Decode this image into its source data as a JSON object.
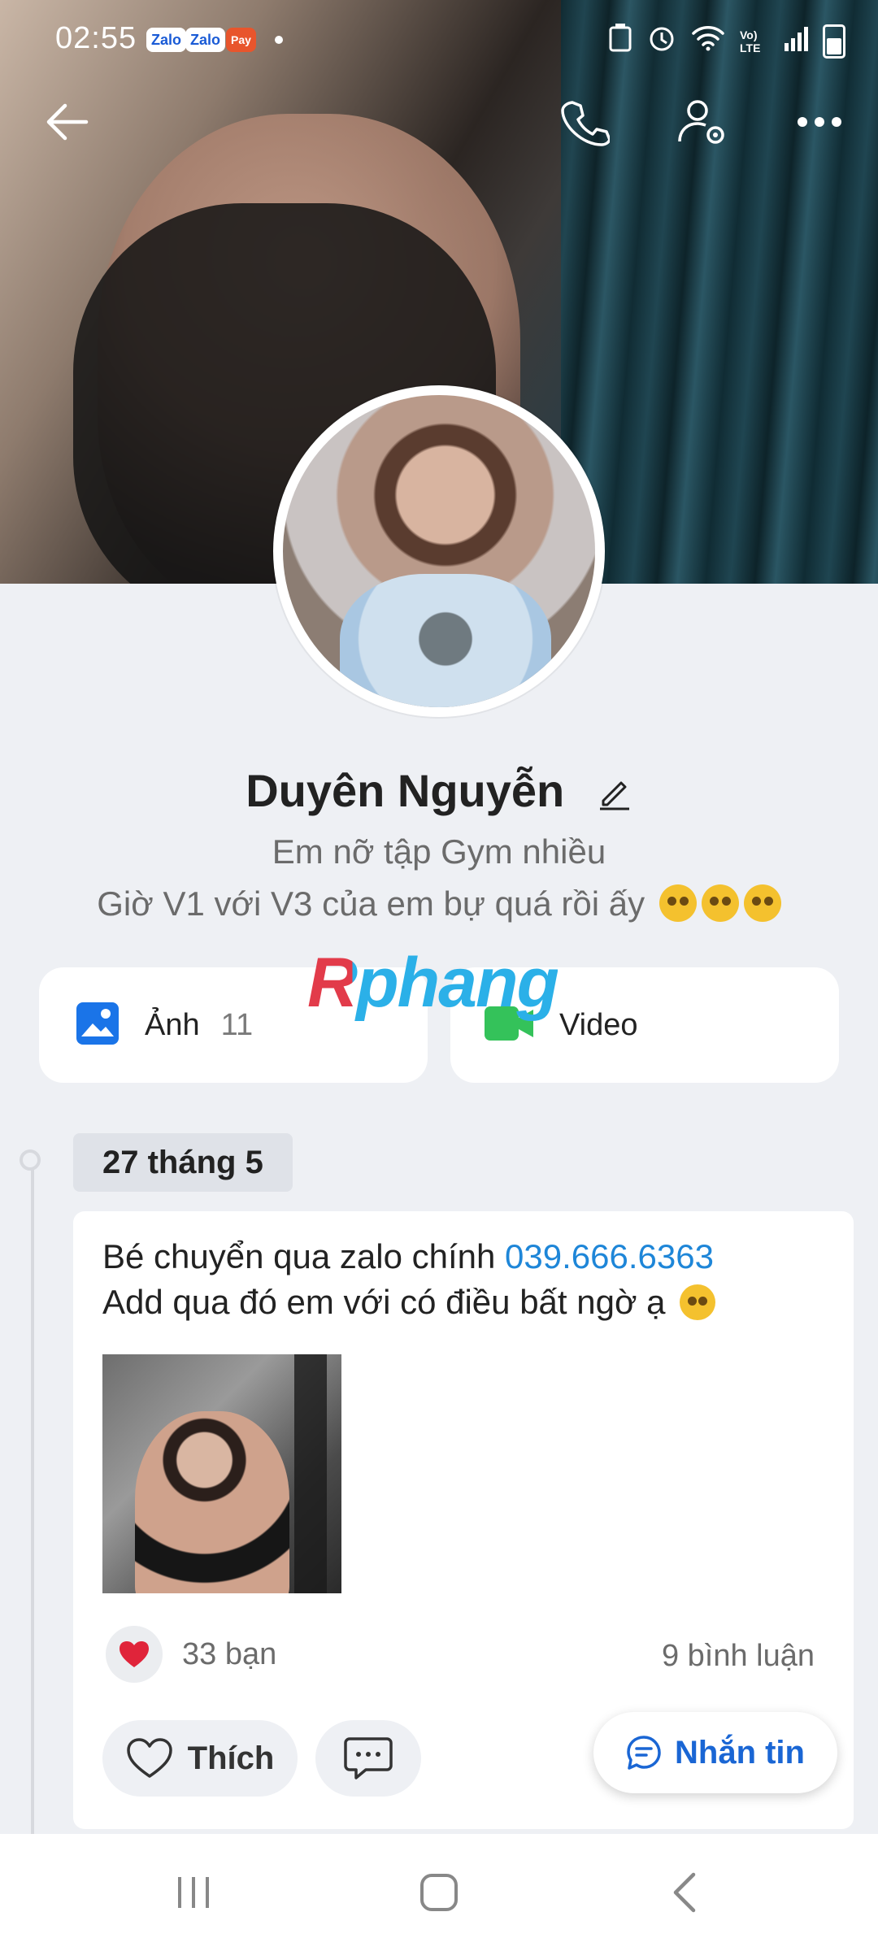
{
  "status_bar": {
    "time": "02:55",
    "notifications": [
      "Zalo",
      "Zalo",
      "Pay"
    ],
    "network_label": "Vo) LTE"
  },
  "header": {
    "back_icon": "back-arrow-icon",
    "call_icon": "phone-icon",
    "settings_icon": "user-settings-icon",
    "more_icon": "more-dots-icon"
  },
  "profile": {
    "name": "Duyên Nguyễn",
    "bio_line1": "Em nỡ tập Gym nhiều",
    "bio_line2": "Giờ V1 với V3 của em bự quá rồi ấy"
  },
  "media": {
    "photos_label": "Ảnh",
    "photos_count": "11",
    "video_label": "Video"
  },
  "watermark": "Rphang",
  "timeline": {
    "date": "27 tháng 5"
  },
  "post": {
    "text_line1_prefix": "Bé chuyển qua zalo chính ",
    "phone": "039.666.6363",
    "text_line2": "Add qua đó em với có điều bất ngờ ạ",
    "reactions_count": "33 bạn",
    "comments_count": "9 bình luận",
    "like_label": "Thích",
    "message_label": "Nhắn tin"
  },
  "colors": {
    "accent": "#1a66d4",
    "phone_link": "#1e86d8",
    "heart": "#e0243a",
    "video_icon": "#34c25a",
    "photo_icon": "#1a74e8"
  }
}
